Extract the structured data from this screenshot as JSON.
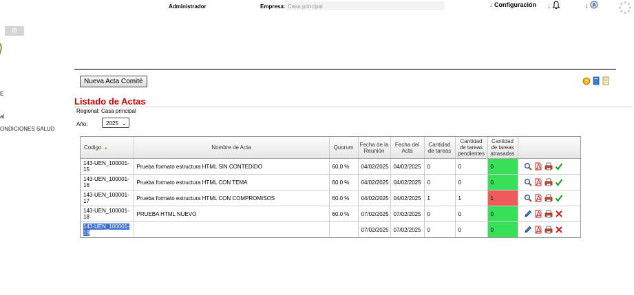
{
  "header": {
    "user_label": "Administrador",
    "empresa_label": "Empresa:",
    "empresa_value": "Casa principal",
    "config_label": "Configuración"
  },
  "sidebar": {
    "items": [
      {
        "label": "E"
      },
      {
        "label": "al"
      },
      {
        "label": "ONDICIONES SALUD"
      }
    ]
  },
  "toolbar": {
    "new_button_label": "Nueva Acta Comité"
  },
  "page": {
    "title": "Listado de Actas",
    "regional": "Regional: Casa principal",
    "year_label": "Año:",
    "year_value": "2025"
  },
  "table": {
    "headers": {
      "codigo": "Codigo",
      "nombre": "Nombre de Acta",
      "quorum": "Quorum",
      "fecha_reunion": "Fecha de la Reunión",
      "fecha_acta": "Fecha del Acta",
      "cant_tareas": "Cantidad de tareas",
      "cant_pendientes": "Cantidad de tareas pendientes",
      "cant_atrasadas": "Cantidad de tareas atrasadas"
    },
    "rows": [
      {
        "codigo": "143-UEN_100001-15",
        "nombre": "Prueba formato estructura HTML SIN CONTEDIDO",
        "quorum": "60.0 %",
        "fecha_reunion": "04/02/2025",
        "fecha_acta": "04/02/2025",
        "tareas": "0",
        "pendientes": "0",
        "atrasadas": "0",
        "status": "green",
        "mode": "view"
      },
      {
        "codigo": "143-UEN_100001-16",
        "nombre": "Prueba formato estructura HTML CON TEMA",
        "quorum": "60.0 %",
        "fecha_reunion": "04/02/2025",
        "fecha_acta": "04/02/2025",
        "tareas": "0",
        "pendientes": "0",
        "atrasadas": "0",
        "status": "green",
        "mode": "view"
      },
      {
        "codigo": "143-UEN_100001-17",
        "nombre": "Prueba formato estructura HTML CON COMPROMISOS",
        "quorum": "60.0 %",
        "fecha_reunion": "04/02/2025",
        "fecha_acta": "04/02/2025",
        "tareas": "1",
        "pendientes": "1",
        "atrasadas": "1",
        "status": "red",
        "mode": "view"
      },
      {
        "codigo": "143-UEN_100001-18",
        "nombre": "PRUEBA HTML NUEVO",
        "quorum": "60.0 %",
        "fecha_reunion": "07/02/2025",
        "fecha_acta": "07/02/2025",
        "tareas": "0",
        "pendientes": "0",
        "atrasadas": "0",
        "status": "green",
        "mode": "edit"
      },
      {
        "codigo": "143-UEN_100001-19",
        "nombre": "",
        "quorum": "",
        "fecha_reunion": "07/02/2025",
        "fecha_acta": "07/02/2025",
        "tareas": "0",
        "pendientes": "0",
        "atrasadas": "0",
        "status": "green",
        "mode": "edit",
        "selected": true
      }
    ]
  },
  "icons": {
    "view_row": [
      "search-icon",
      "pdf-icon",
      "print-icon",
      "check-icon"
    ],
    "edit_row": [
      "pencil-icon",
      "pdf-icon",
      "print-icon",
      "delete-icon"
    ]
  },
  "colors": {
    "title": "#c80000",
    "green_status": "#38e05a",
    "red_status": "#ef5a5a",
    "selection": "#3d6fd1",
    "link_arrow": "#1a55b8"
  }
}
